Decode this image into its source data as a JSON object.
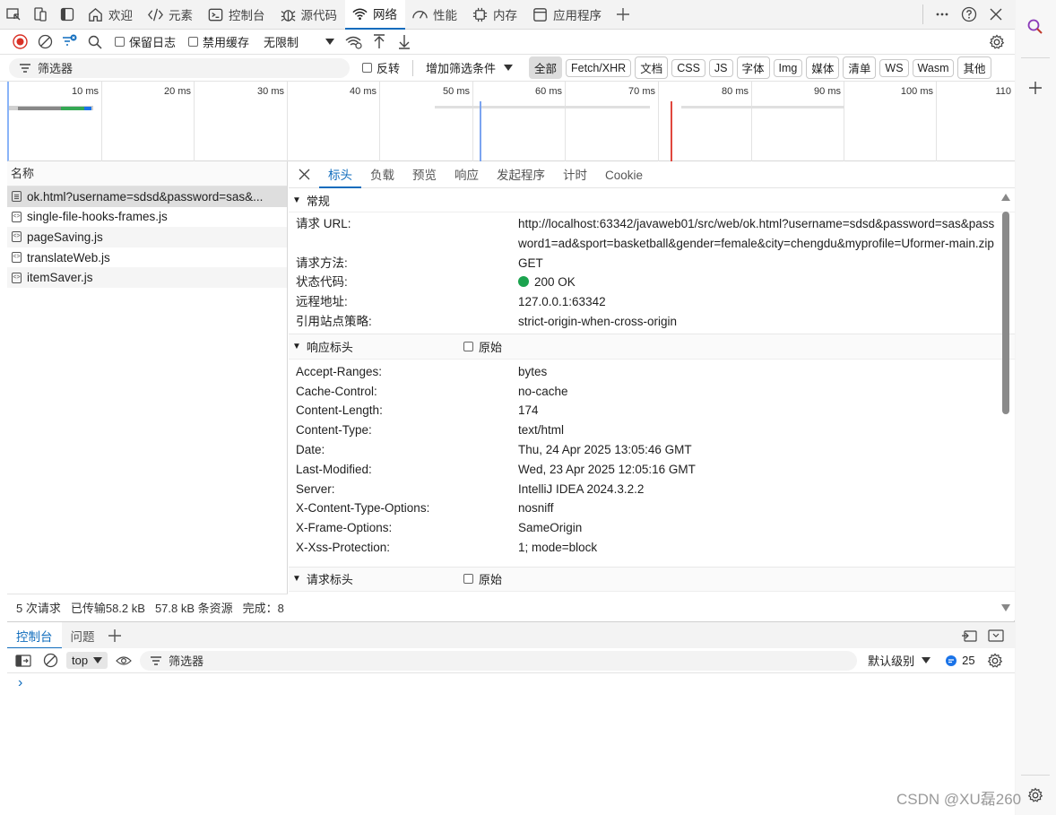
{
  "tabs": [
    {
      "label": "欢迎",
      "icon": "home-icon"
    },
    {
      "label": "元素",
      "icon": "code-icon"
    },
    {
      "label": "控制台",
      "icon": "console-icon"
    },
    {
      "label": "源代码",
      "icon": "bug-icon"
    },
    {
      "label": "网络",
      "icon": "wifi-icon",
      "active": true
    },
    {
      "label": "性能",
      "icon": "gauge-icon"
    },
    {
      "label": "内存",
      "icon": "chip-icon"
    },
    {
      "label": "应用程序",
      "icon": "app-icon"
    }
  ],
  "toolbar": {
    "preserve_log": "保留日志",
    "disable_cache": "禁用缓存",
    "throttling": "无限制"
  },
  "filter": {
    "placeholder": "筛选器",
    "invert": "反转",
    "more_filters": "增加筛选条件",
    "types": [
      "全部",
      "Fetch/XHR",
      "文档",
      "CSS",
      "JS",
      "字体",
      "Img",
      "媒体",
      "清单",
      "WS",
      "Wasm",
      "其他"
    ]
  },
  "timeline": {
    "ticks": [
      "10 ms",
      "20 ms",
      "30 ms",
      "40 ms",
      "50 ms",
      "60 ms",
      "70 ms",
      "80 ms",
      "90 ms",
      "100 ms",
      "110"
    ]
  },
  "requests": {
    "header": "名称",
    "rows": [
      {
        "name": "ok.html?username=sdsd&password=sas&...",
        "type": "doc"
      },
      {
        "name": "single-file-hooks-frames.js",
        "type": "js"
      },
      {
        "name": "pageSaving.js",
        "type": "js"
      },
      {
        "name": "translateWeb.js",
        "type": "js"
      },
      {
        "name": "itemSaver.js",
        "type": "js"
      }
    ]
  },
  "status": {
    "requests": "5 次请求",
    "transferred": "已传输58.2 kB",
    "resources": "57.8 kB 条资源",
    "finish": "完成：8"
  },
  "detail_tabs": [
    "标头",
    "负载",
    "预览",
    "响应",
    "发起程序",
    "计时",
    "Cookie"
  ],
  "general": {
    "title": "常规",
    "rows": [
      {
        "key": "请求 URL:",
        "value": "http://localhost:63342/javaweb01/src/web/ok.html?username=sdsd&password=sas&password1=ad&sport=basketball&gender=female&city=chengdu&myprofile=Uformer-main.zip"
      },
      {
        "key": "请求方法:",
        "value": "GET"
      },
      {
        "key": "状态代码:",
        "value": "200 OK"
      },
      {
        "key": "远程地址:",
        "value": "127.0.0.1:63342"
      },
      {
        "key": "引用站点策略:",
        "value": "strict-origin-when-cross-origin"
      }
    ]
  },
  "response_headers": {
    "title": "响应标头",
    "raw": "原始",
    "rows": [
      {
        "key": "Accept-Ranges:",
        "value": "bytes"
      },
      {
        "key": "Cache-Control:",
        "value": "no-cache"
      },
      {
        "key": "Content-Length:",
        "value": "174"
      },
      {
        "key": "Content-Type:",
        "value": "text/html"
      },
      {
        "key": "Date:",
        "value": "Thu, 24 Apr 2025 13:05:46 GMT"
      },
      {
        "key": "Last-Modified:",
        "value": "Wed, 23 Apr 2025 12:05:16 GMT"
      },
      {
        "key": "Server:",
        "value": "IntelliJ IDEA 2024.3.2.2"
      },
      {
        "key": "X-Content-Type-Options:",
        "value": "nosniff"
      },
      {
        "key": "X-Frame-Options:",
        "value": "SameOrigin"
      },
      {
        "key": "X-Xss-Protection:",
        "value": "1; mode=block"
      }
    ]
  },
  "request_headers": {
    "title": "请求标头",
    "raw": "原始"
  },
  "drawer": {
    "tabs": [
      "控制台",
      "问题"
    ],
    "context": "top",
    "filter_placeholder": "筛选器",
    "level": "默认级别",
    "issues_count": "25"
  },
  "watermark": "CSDN @XU磊260"
}
